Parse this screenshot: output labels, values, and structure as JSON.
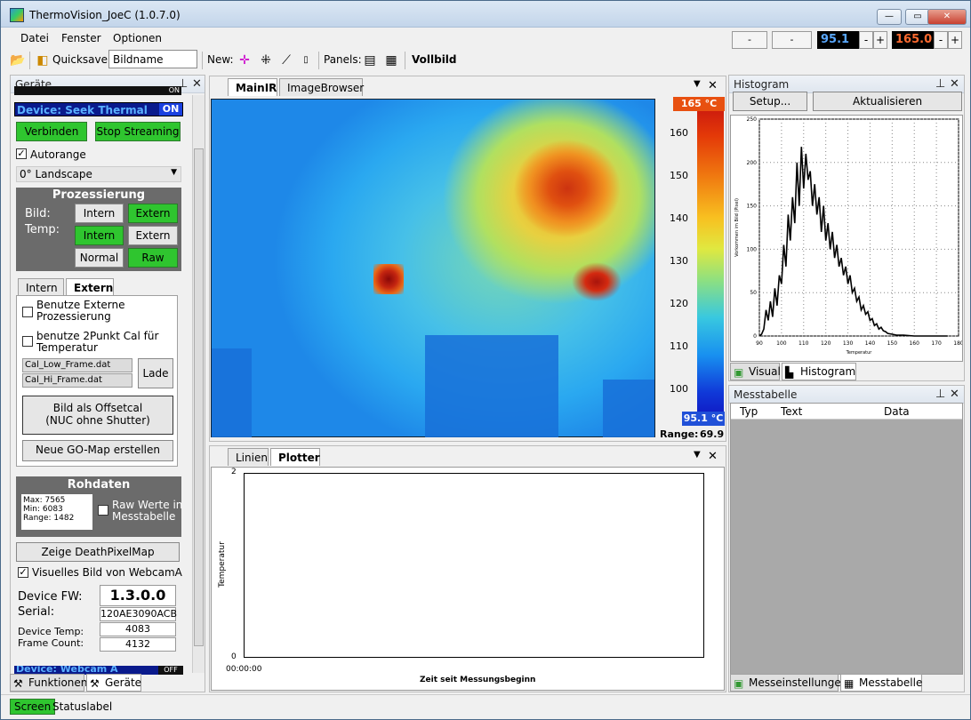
{
  "window": {
    "title": "ThermoVision_JoeC (1.0.7.0)"
  },
  "menu": {
    "items": [
      "Datei",
      "Fenster",
      "Optionen"
    ]
  },
  "top_controls": {
    "field1": "-",
    "field2": "-",
    "temp_low": "95.1",
    "temp_high": "165.0",
    "minus": "-",
    "plus": "+",
    "temp_low_color": "#5aa8ff",
    "temp_high_color": "#ff6a30"
  },
  "toolbar": {
    "quicksave_label": "Quicksave:",
    "quicksave_value": "Bildname",
    "new_label": "New:",
    "panels_label": "Panels:",
    "fullscreen_label": "Vollbild"
  },
  "devices_panel": {
    "title": "Geräte",
    "device_header": "Device: Seek Thermal",
    "device_status": "ON",
    "connect_button": "Verbinden",
    "stop_button": "Stop Streaming",
    "autorange_label": "Autorange",
    "orientation_value": "0° Landscape",
    "processing": {
      "title": "Prozessierung",
      "bild_label": "Bild:",
      "temp_label": "Temp:",
      "bild_intern": "Intern",
      "bild_extern": "Extern",
      "temp_intern": "Intern",
      "temp_extern": "Extern",
      "normal": "Normal",
      "raw": "Raw"
    },
    "tabs": [
      "Intern",
      "Extern"
    ],
    "extern": {
      "use_external": "Benutze Externe Prozessierung",
      "use_2point_line1": "benutze 2Punkt Cal für",
      "use_2point_line2": "Temperatur",
      "cal_low": "Cal_Low_Frame.dat",
      "cal_hi": "Cal_Hi_Frame.dat",
      "load_button": "Lade",
      "offset_line1": "Bild als Offsetcal",
      "offset_line2": "(NUC ohne Shutter)",
      "gomap_button": "Neue GO-Map erstellen"
    },
    "rawdata": {
      "title": "Rohdaten",
      "max": "Max: 7565",
      "min": "Min: 6083",
      "range": "Range: 1482",
      "raw_to_table_line1": "Raw Werte in",
      "raw_to_table_line2": "Messtabelle"
    },
    "deathpixel_button": "Zeige DeathPixelMap",
    "webcam_label": "Visuelles Bild von WebcamA",
    "device_fw_label": "Device FW:",
    "device_fw_value": "1.3.0.0",
    "serial_label": "Serial:",
    "serial_value": "120AE3090ACB",
    "device_temp_label": "Device Temp:",
    "device_temp_value": "4083",
    "frame_count_label": "Frame Count:",
    "frame_count_value": "4132",
    "next_device": "Device: Webcam A",
    "next_device_status": "OFF",
    "prev_device_status": "ON",
    "bottom_tabs": [
      "Funktionen",
      "Geräte"
    ]
  },
  "main_panel": {
    "tabs": [
      "MainIR",
      "ImageBrowser"
    ],
    "colorbar_max": "165 °C",
    "colorbar_min": "95.1 °C",
    "colorbar_ticks": [
      "160",
      "150",
      "140",
      "130",
      "120",
      "110",
      "100"
    ],
    "range_label": "Range:",
    "range_value": "69.9"
  },
  "plotter_panel": {
    "tabs": [
      "Linien",
      "Plotter"
    ],
    "ylabel": "Temperatur",
    "xlabel": "Zeit seit Messungsbeginn",
    "ymax": "2",
    "ymin": "0",
    "xstart": "00:00:00"
  },
  "histogram_panel": {
    "title": "Histogram",
    "setup_button": "Setup...",
    "refresh_button": "Aktualisieren",
    "ylabel": "Vorkommen im Bild (Pixel)",
    "xlabel": "Temperatur",
    "yticks": [
      "250",
      "200",
      "150",
      "100",
      "50",
      "0"
    ],
    "xticks": [
      "90",
      "100",
      "110",
      "120",
      "130",
      "140",
      "150",
      "160",
      "170",
      "180"
    ],
    "bottom_tabs": [
      "Visual",
      "Histogram"
    ]
  },
  "measure_panel": {
    "title": "Messtabelle",
    "columns": [
      "Typ",
      "Text",
      "Data"
    ],
    "bottom_tabs": [
      "Messeinstellungen",
      "Messtabelle"
    ]
  },
  "status": {
    "screen": "Screen",
    "label": "Statuslabel"
  },
  "chart_data": {
    "type": "line",
    "x": [
      88,
      90,
      91,
      92,
      93,
      94,
      95,
      96,
      97,
      98,
      99,
      100,
      101,
      102,
      103,
      104,
      105,
      106,
      107,
      108,
      109,
      110,
      111,
      112,
      113,
      114,
      115,
      116,
      117,
      118,
      119,
      120,
      121,
      122,
      123,
      124,
      125,
      126,
      127,
      128,
      129,
      130,
      131,
      132,
      133,
      134,
      135,
      136,
      137,
      138,
      139,
      140,
      141,
      142,
      143,
      144,
      145,
      146,
      147,
      148,
      150,
      152,
      155,
      160,
      165,
      170,
      175
    ],
    "values": [
      0,
      0,
      2,
      8,
      30,
      18,
      40,
      22,
      55,
      35,
      70,
      60,
      105,
      80,
      140,
      110,
      160,
      130,
      200,
      150,
      218,
      170,
      210,
      180,
      190,
      150,
      175,
      140,
      160,
      120,
      150,
      110,
      130,
      100,
      120,
      90,
      105,
      80,
      90,
      70,
      80,
      60,
      70,
      50,
      55,
      40,
      45,
      30,
      35,
      25,
      28,
      18,
      20,
      12,
      14,
      8,
      10,
      6,
      5,
      3,
      2,
      1,
      1,
      0,
      0,
      0,
      0
    ],
    "xlabel": "Temperatur",
    "ylabel": "Vorkommen im Bild (Pixel)",
    "xlim": [
      90,
      180
    ],
    "ylim": [
      0,
      250
    ],
    "grid": true
  }
}
